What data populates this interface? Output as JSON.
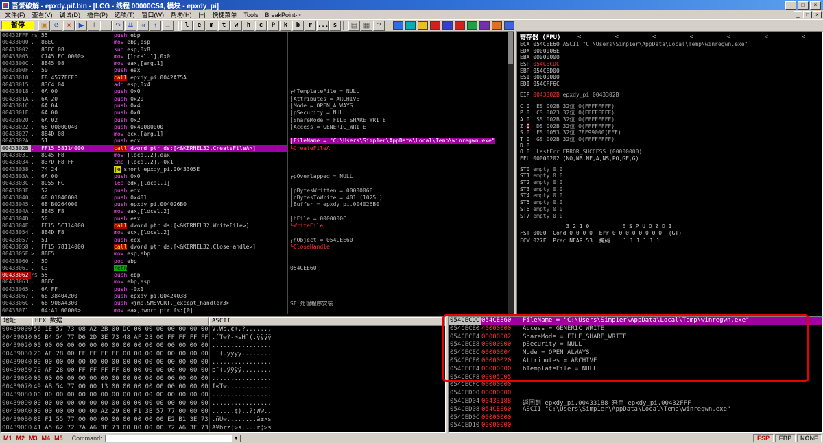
{
  "window": {
    "title": "吾爱破解 - epxdy.pif.bin - [LCG - 线程 00000C54, 模块 - epxdy_pi]",
    "controls": [
      "_",
      "□",
      "×"
    ]
  },
  "menu": {
    "items": [
      "文件(F)",
      "查看(V)",
      "调试(D)",
      "插件(P)",
      "选项(T)",
      "窗口(W)",
      "帮助(H)",
      "|+|",
      "快捷菜单",
      "Tools",
      "BreakPoint->"
    ],
    "child_controls": [
      "_",
      "□",
      "×"
    ]
  },
  "toolbar": {
    "status": "暂停",
    "icon_buttons": [
      {
        "name": "open-file-icon",
        "g": "▣",
        "c": "#c08020"
      },
      {
        "name": "restart-icon",
        "g": "↺",
        "c": "#2050c0"
      },
      {
        "name": "close-icon",
        "g": "×",
        "c": "#c02020"
      },
      {
        "name": "run-icon",
        "g": "▶",
        "c": "#2050c0"
      },
      {
        "name": "pause-icon",
        "g": "‖",
        "c": "#606060"
      },
      {
        "name": "step-into-icon",
        "g": "↓",
        "c": "#2050c0"
      },
      {
        "name": "step-over-icon",
        "g": "↷",
        "c": "#2050c0"
      },
      {
        "name": "animate-into-icon",
        "g": "⇊",
        "c": "#2050c0"
      },
      {
        "name": "animate-over-icon",
        "g": "↠",
        "c": "#2050c0"
      },
      {
        "name": "until-return-icon",
        "g": "↑",
        "c": "#2050c0"
      },
      {
        "name": "goto-icon",
        "g": "→",
        "c": "#2050c0"
      }
    ],
    "letter_buttons": [
      "l",
      "e",
      "m",
      "t",
      "w",
      "h",
      "c",
      "P",
      "k",
      "b",
      "r",
      "...",
      "s"
    ],
    "extra_buttons": [
      {
        "name": "options-icon",
        "g": "▤",
        "c": "#404040"
      },
      {
        "name": "appearance-icon",
        "g": "▦",
        "c": "#404040"
      },
      {
        "name": "help-icon",
        "g": "?",
        "c": "#404040"
      }
    ],
    "plugin_buttons": [
      {
        "name": "plugin-icon-1",
        "c": "#2b6fe0"
      },
      {
        "name": "plugin-icon-2",
        "c": "#00b0b0"
      },
      {
        "name": "plugin-icon-3",
        "c": "#e8c020"
      },
      {
        "name": "plugin-icon-4",
        "c": "#d02020"
      },
      {
        "name": "plugin-icon-5",
        "c": "#3040d0"
      },
      {
        "name": "plugin-icon-6",
        "c": "#d02020"
      },
      {
        "name": "plugin-icon-7",
        "c": "#20a040"
      },
      {
        "name": "plugin-icon-8",
        "c": "#7030b0"
      },
      {
        "name": "plugin-icon-9",
        "c": "#e07020"
      },
      {
        "name": "plugin-icon-10",
        "c": "#4060e0"
      }
    ]
  },
  "disasm": {
    "rows": [
      {
        "a": "00432FFF",
        "m": "r$",
        "b": "55",
        "mn": "push",
        "op": "ebp"
      },
      {
        "a": "00433000",
        "m": ".",
        "b": "8BEC",
        "mn": "mov",
        "op": "ebp,esp"
      },
      {
        "a": "00433002",
        "m": ".",
        "b": "83EC 08",
        "mn": "sub",
        "op": "esp,0x8"
      },
      {
        "a": "00433005",
        "m": ".",
        "b": "C745 FC 0000>",
        "mn": "mov",
        "op": "[local.1],0x0"
      },
      {
        "a": "0043300C",
        "m": ".",
        "b": "8B45 08",
        "mn": "mov",
        "op": "eax,[arg.1]"
      },
      {
        "a": "0043300F",
        "m": ".",
        "b": "50",
        "mn": "push",
        "op": "eax"
      },
      {
        "a": "00433010",
        "m": ".",
        "b": "E8 4577FFFF",
        "mn": "call",
        "op": "epxdy_pi.0042A75A",
        "mk": "call"
      },
      {
        "a": "00433015",
        "m": ".",
        "b": "83C4 04",
        "mn": "add",
        "op": "esp,0x4"
      },
      {
        "a": "00433018",
        "m": ".",
        "b": "6A 00",
        "mn": "push",
        "op": "0x0",
        "c": "┌hTemplateFile = NULL"
      },
      {
        "a": "0043301A",
        "m": ".",
        "b": "6A 20",
        "mn": "push",
        "op": "0x20",
        "c": "│Attributes = ARCHIVE"
      },
      {
        "a": "0043301C",
        "m": ".",
        "b": "6A 04",
        "mn": "push",
        "op": "0x4",
        "c": "│Mode = OPEN_ALWAYS"
      },
      {
        "a": "0043301E",
        "m": ".",
        "b": "6A 00",
        "mn": "push",
        "op": "0x0",
        "c": "│pSecurity = NULL"
      },
      {
        "a": "00433020",
        "m": ".",
        "b": "6A 02",
        "mn": "push",
        "op": "0x2",
        "c": "│ShareMode = FILE_SHARE_WRITE"
      },
      {
        "a": "00433022",
        "m": ".",
        "b": "68 00000040",
        "mn": "push",
        "op": "0x40000000",
        "c": "│Access = GENERIC_WRITE"
      },
      {
        "a": "00433027",
        "m": ".",
        "b": "8B4D 08",
        "mn": "mov",
        "op": "ecx,[arg.1]"
      },
      {
        "a": "0043302A",
        "m": ".",
        "b": "51",
        "mn": "push",
        "op": "ecx",
        "c": "│FileName = \"C:\\Users\\Simp1er\\AppData\\Local\\Temp\\winregwn.exe\"",
        "ch": "sel"
      },
      {
        "a": "0043302B",
        "m": ".",
        "b": "FF15 58114000",
        "mn": "call",
        "op": "dword ptr ds:[<&KERNEL32.CreateFileA>]",
        "mk": "call",
        "k": "sel",
        "c": "└CreateFileA",
        "cc": "api"
      },
      {
        "a": "00433031",
        "m": ".",
        "b": "8945 F8",
        "mn": "mov",
        "op": "[local.2],eax"
      },
      {
        "a": "00433034",
        "m": ".",
        "b": "837D F8 FF",
        "mn": "cmp",
        "op": "[local.2],-0x1"
      },
      {
        "a": "00433038",
        "m": ".",
        "b": "74 24",
        "mn": "je",
        "op": "short epxdy_pi.0043305E",
        "mk": "jump"
      },
      {
        "a": "0043303A",
        "m": ".",
        "b": "6A 00",
        "mn": "push",
        "op": "0x0",
        "c": "┌pOverlapped = NULL"
      },
      {
        "a": "0043303C",
        "m": ".",
        "b": "8D55 FC",
        "mn": "lea",
        "op": "edx,[local.1]"
      },
      {
        "a": "0043303F",
        "m": ".",
        "b": "52",
        "mn": "push",
        "op": "edx",
        "c": "│pBytesWritten = 0000006E"
      },
      {
        "a": "00433040",
        "m": ".",
        "b": "68 01040000",
        "mn": "push",
        "op": "0x401",
        "c": "│nBytesToWrite = 401 (1025.)"
      },
      {
        "a": "00433045",
        "m": ".",
        "b": "68 B0264000",
        "mn": "push",
        "op": "epxdy_pi.004026B0",
        "c": "│Buffer = epxdy_pi.004026B0"
      },
      {
        "a": "0043304A",
        "m": ".",
        "b": "8B45 F8",
        "mn": "mov",
        "op": "eax,[local.2]"
      },
      {
        "a": "0043304D",
        "m": ".",
        "b": "50",
        "mn": "push",
        "op": "eax",
        "c": "│hFile = 0000000C"
      },
      {
        "a": "0043304E",
        "m": ".",
        "b": "FF15 5C114000",
        "mn": "call",
        "op": "dword ptr ds:[<&KERNEL32.WriteFile>]",
        "mk": "call",
        "c": "└WriteFile",
        "cc": "api"
      },
      {
        "a": "00433054",
        "m": ".",
        "b": "8B4D F8",
        "mn": "mov",
        "op": "ecx,[local.2]"
      },
      {
        "a": "00433057",
        "m": ".",
        "b": "51",
        "mn": "push",
        "op": "ecx",
        "c": "┌hObject = 054CEE60"
      },
      {
        "a": "00433058",
        "m": ".",
        "b": "FF15 78114000",
        "mn": "call",
        "op": "dword ptr ds:[<&KERNEL32.CloseHandle>]",
        "mk": "call",
        "c": "└CloseHandle",
        "cc": "api"
      },
      {
        "a": "0043305E",
        "m": ">",
        "b": "8BE5",
        "mn": "mov",
        "op": "esp,ebp"
      },
      {
        "a": "00433060",
        "m": ".",
        "b": "5D",
        "mn": "pop",
        "op": "ebp"
      },
      {
        "a": "00433061",
        "m": ".",
        "b": "C3",
        "mn": "retn",
        "op": "",
        "mk": "ret",
        "c": "054CEE60"
      },
      {
        "a": "00433062",
        "m": "r$",
        "b": "55",
        "mn": "push",
        "op": "ebp",
        "ak": "bp"
      },
      {
        "a": "00433063",
        "m": ".",
        "b": "8BEC",
        "mn": "mov",
        "op": "ebp,esp"
      },
      {
        "a": "00433065",
        "m": ".",
        "b": "6A FF",
        "mn": "push",
        "op": "-0x1"
      },
      {
        "a": "00433067",
        "m": ".",
        "b": "68 38404200",
        "mn": "push",
        "op": "epxdy_pi.00424038"
      },
      {
        "a": "0043306C",
        "m": ".",
        "b": "68 908A4300",
        "mn": "push",
        "op": "<jmp.&MSVCRT._except_handler3>",
        "c": "SE 处理程序安装"
      },
      {
        "a": "00433071",
        "m": ".",
        "b": "64:A1 00000>",
        "mn": "mov",
        "op": "eax,dword ptr fs:[0]"
      }
    ]
  },
  "registers": {
    "title": "寄存器 (FPU)",
    "history_buttons": [
      "<",
      "<",
      "<",
      "<",
      "<",
      "<",
      "<"
    ],
    "gpr": [
      {
        "n": "ECX",
        "v": "054CEE60",
        "x": "ASCII \"C:\\Users\\Simp1er\\AppData\\Local\\Temp\\winregwn.exe\""
      },
      {
        "n": "EDX",
        "v": "0000006E"
      },
      {
        "n": "EBX",
        "v": "00000000"
      },
      {
        "n": "ESP",
        "v": "054CECDC",
        "hl": true
      },
      {
        "n": "EBP",
        "v": "054CED00"
      },
      {
        "n": "ESI",
        "v": "00000000"
      },
      {
        "n": "EDI",
        "v": "054CFF6C"
      }
    ],
    "eip": {
      "n": "EIP",
      "v": "0043302B",
      "x": "epxdy_pi.0043302B",
      "hl": true
    },
    "flags": [
      {
        "f": "C",
        "v": "0",
        "rest": "ES 002B 32位 0(FFFFFFFF)"
      },
      {
        "f": "P",
        "v": "0",
        "rest": "CS 0023 32位 0(FFFFFFFF)"
      },
      {
        "f": "A",
        "v": "0",
        "rest": "SS 002B 32位 0(FFFFFFFF)"
      },
      {
        "f": "Z",
        "v": "0",
        "rest": "DS 002B 32位 0(FFFFFFFF)",
        "hl": true
      },
      {
        "f": "S",
        "v": "0",
        "rest": "FS 0053 32位 7EF99000(FFF)"
      },
      {
        "f": "T",
        "v": "0",
        "rest": "GS 002B 32位 0(FFFFFFFF)"
      },
      {
        "f": "D",
        "v": "0",
        "rest": ""
      },
      {
        "f": "O",
        "v": "0",
        "rest": "LastErr ERROR_SUCCESS (00000000)"
      }
    ],
    "efl": "EFL 00000202 (NO,NB,NE,A,NS,PO,GE,G)",
    "fpu": [
      {
        "n": "ST0",
        "v": "empty 0.0"
      },
      {
        "n": "ST1",
        "v": "empty 0.0"
      },
      {
        "n": "ST2",
        "v": "empty 0.0"
      },
      {
        "n": "ST3",
        "v": "empty 0.0"
      },
      {
        "n": "ST4",
        "v": "empty 0.0"
      },
      {
        "n": "ST5",
        "v": "empty 0.0"
      },
      {
        "n": "ST6",
        "v": "empty 0.0"
      },
      {
        "n": "ST7",
        "v": "empty 0.0"
      }
    ],
    "fpu_bits": "              3 2 1 0          E S P U O Z D I",
    "fst": "FST 0000  Cond 0 0 0 0  Err 0 0 0 0 0 0 0 0  (GT)",
    "fcw": "FCW 027F  Prec NEAR,53  掩码    1 1 1 1 1 1"
  },
  "dump": {
    "headers": [
      "地址",
      "HEX 数据",
      "ASCII"
    ],
    "rows": [
      {
        "a": "00439000",
        "h": "56 1E 57 73 08 A2 2B 00 DC 00 00 00 00 00 00 00",
        "s": "V.Ws.¢+.?......."
      },
      {
        "a": "00439010",
        "h": "06 B4 54 77 D6 2D 3E 73 48 AF 28 00 FF FF FF FF",
        "s": ".´Tw?->sH¯(.ÿÿÿÿ"
      },
      {
        "a": "00439020",
        "h": "00 00 00 00 00 00 00 00 00 00 00 00 00 00 00 00",
        "s": "................"
      },
      {
        "a": "00439030",
        "h": "20 AF 28 00 FF FF FF FF 00 00 00 00 00 00 00 00",
        "s": " ¯(.ÿÿÿÿ........"
      },
      {
        "a": "00439040",
        "h": "00 00 00 00 00 00 00 00 00 00 00 00 00 00 00 00",
        "s": "................"
      },
      {
        "a": "00439050",
        "h": "70 AF 28 00 FF FF FF FF 00 00 00 00 00 00 00 00",
        "s": "p¯(.ÿÿÿÿ........"
      },
      {
        "a": "00439060",
        "h": "00 00 00 00 00 00 00 00 00 00 00 00 00 00 00 00",
        "s": "................"
      },
      {
        "a": "00439070",
        "h": "49 AB 54 77 00 00 13 00 00 00 00 00 00 00 00 00",
        "s": "I«Tw............"
      },
      {
        "a": "00439080",
        "h": "00 00 00 00 00 00 00 00 00 00 00 00 00 00 00 00",
        "s": "................"
      },
      {
        "a": "00439090",
        "h": "00 00 00 00 00 00 00 00 00 00 00 00 00 00 00 00",
        "s": "................"
      },
      {
        "a": "004390A0",
        "h": "00 00 00 00 00 00 A2 29 00 F1 3B 57 77 00 00 00",
        "s": "......¢)..?;Ww.."
      },
      {
        "a": "004390B0",
        "h": "8E F1 55 77 00 00 00 00 00 00 00 00 E2 B1 3E 73",
        "s": ".ñUw........â±>s"
      },
      {
        "a": "004390C0",
        "h": "41 A5 62 72 7A A6 3E 73 00 00 00 00 72 A6 3E 73",
        "s": "A¥brz¦>s....r¦>s"
      }
    ]
  },
  "stack": {
    "rows": [
      {
        "a": "054CECDC",
        "v": "054CEE60",
        "c": "FileName = \"C:\\Users\\Simp1er\\AppData\\Local\\Temp\\winregwn.exe\"",
        "sel": true
      },
      {
        "a": "054CECE0",
        "v": "40000000",
        "c": "Access = GENERIC_WRITE"
      },
      {
        "a": "054CECE4",
        "v": "00000002",
        "c": "ShareMode = FILE_SHARE_WRITE"
      },
      {
        "a": "054CECE8",
        "v": "00000000",
        "c": "pSecurity = NULL"
      },
      {
        "a": "054CECEC",
        "v": "00000004",
        "c": "Mode = OPEN_ALWAYS"
      },
      {
        "a": "054CECF0",
        "v": "00000020",
        "c": "Attributes = ARCHIVE"
      },
      {
        "a": "054CECF4",
        "v": "00000000",
        "c": "hTemplateFile = NULL"
      },
      {
        "a": "054CECF8",
        "v": "00005C05",
        "c": ""
      },
      {
        "a": "054CECFC",
        "v": "00000000",
        "c": ""
      },
      {
        "a": "054CED00",
        "v": "00000000",
        "c": ""
      },
      {
        "a": "054CED04",
        "v": "00433188",
        "c": "返回到 epxdy_pi.00433188 来自 epxdy_pi.00432FFF"
      },
      {
        "a": "054CED08",
        "v": "054CEE60",
        "c": "ASCII \"C:\\Users\\Simp1er\\AppData\\Local\\Temp\\winregwn.exe\""
      },
      {
        "a": "054CED0C",
        "v": "00000000",
        "c": ""
      },
      {
        "a": "054CED10",
        "v": "00000000",
        "c": ""
      }
    ]
  },
  "statusbar": {
    "tabs": [
      "M1",
      "M2",
      "M3",
      "M4",
      "M5"
    ],
    "command_label": "Command:",
    "command_value": "",
    "dropdown_glyph": "▼",
    "right": [
      "ESP",
      "EBP",
      "NONE"
    ]
  }
}
